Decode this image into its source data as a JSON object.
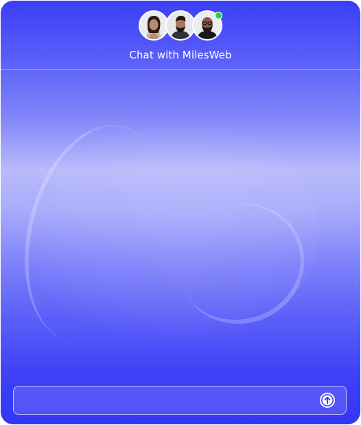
{
  "header": {
    "title": "Chat with MilesWeb",
    "online_status": "online"
  },
  "avatars": [
    {
      "name": "agent-avatar-1"
    },
    {
      "name": "agent-avatar-2"
    },
    {
      "name": "agent-avatar-3"
    }
  ],
  "composer": {
    "value": "",
    "placeholder": "",
    "send_icon": "arrow-up-circle-icon"
  },
  "colors": {
    "accent": "#3336f5",
    "online": "#27d43b"
  }
}
